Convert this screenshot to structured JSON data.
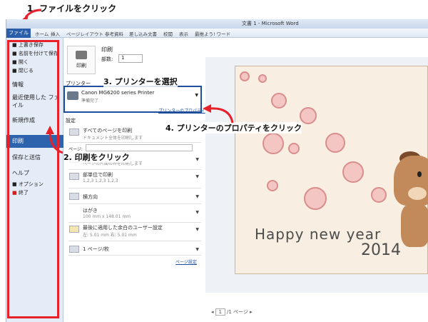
{
  "callouts": {
    "step1": "1. ファイルをクリック",
    "step2": "2. 印刷をクリック",
    "step3": "3. プリンターを選択",
    "step4": "4. プリンターのプロパティをクリック"
  },
  "window": {
    "title": "文書 1 - Microsoft Word"
  },
  "ribbon": {
    "file_tab": "ファイル",
    "tabs": [
      "ホーム",
      "挿入",
      "ページレイアウト",
      "参考資料",
      "差し込み文書",
      "校閲",
      "表示",
      "最推よう! ワード"
    ]
  },
  "nav": {
    "items_small": [
      "上書き保存",
      "名前を付けて保存",
      "開く",
      "閉じる"
    ],
    "info": "情報",
    "recent": "最近使用した ファイル",
    "new": "新規作成",
    "print": "印刷",
    "save_send": "保存と送信",
    "help": "ヘルプ",
    "options": "オプション",
    "exit": "終了"
  },
  "print_panel": {
    "header": "印刷",
    "copies_label": "部数:",
    "copies_value": "1",
    "print_button": "印刷",
    "printer_section": "プリンター",
    "printer_name": "Canon MG6200 series Printer",
    "printer_status": "準備完了",
    "printer_properties": "プリンターのプロパティ",
    "settings_section": "設定",
    "setting_pages": "すべてのページを印刷",
    "setting_pages_sub": "ドキュメント全体を印刷します",
    "setting_pages_label": "ページ:",
    "setting_sides_sub": "ページの片面のみを印刷します",
    "setting_collate": "部単位で印刷",
    "setting_collate_sub": "1,2,3    1,2,3    1,2,3",
    "setting_orientation": "横方向",
    "setting_paper": "はがき",
    "setting_paper_sub": "100 mm x 148.01 mm",
    "setting_margins": "最後に適用した余白のユーザー設定",
    "setting_margins_sub": "左: 5.01 mm    右: 5.01 mm",
    "setting_per_sheet": "1 ページ/枚",
    "page_setup": "ページ設定"
  },
  "preview": {
    "greeting": "Happy new year",
    "year": "2014",
    "page_current": "1",
    "page_total": "/1 ページ"
  },
  "colors": {
    "accent": "#2d62ad",
    "annotation_red": "#e8202a",
    "printer_box": "#1e4f9c"
  }
}
